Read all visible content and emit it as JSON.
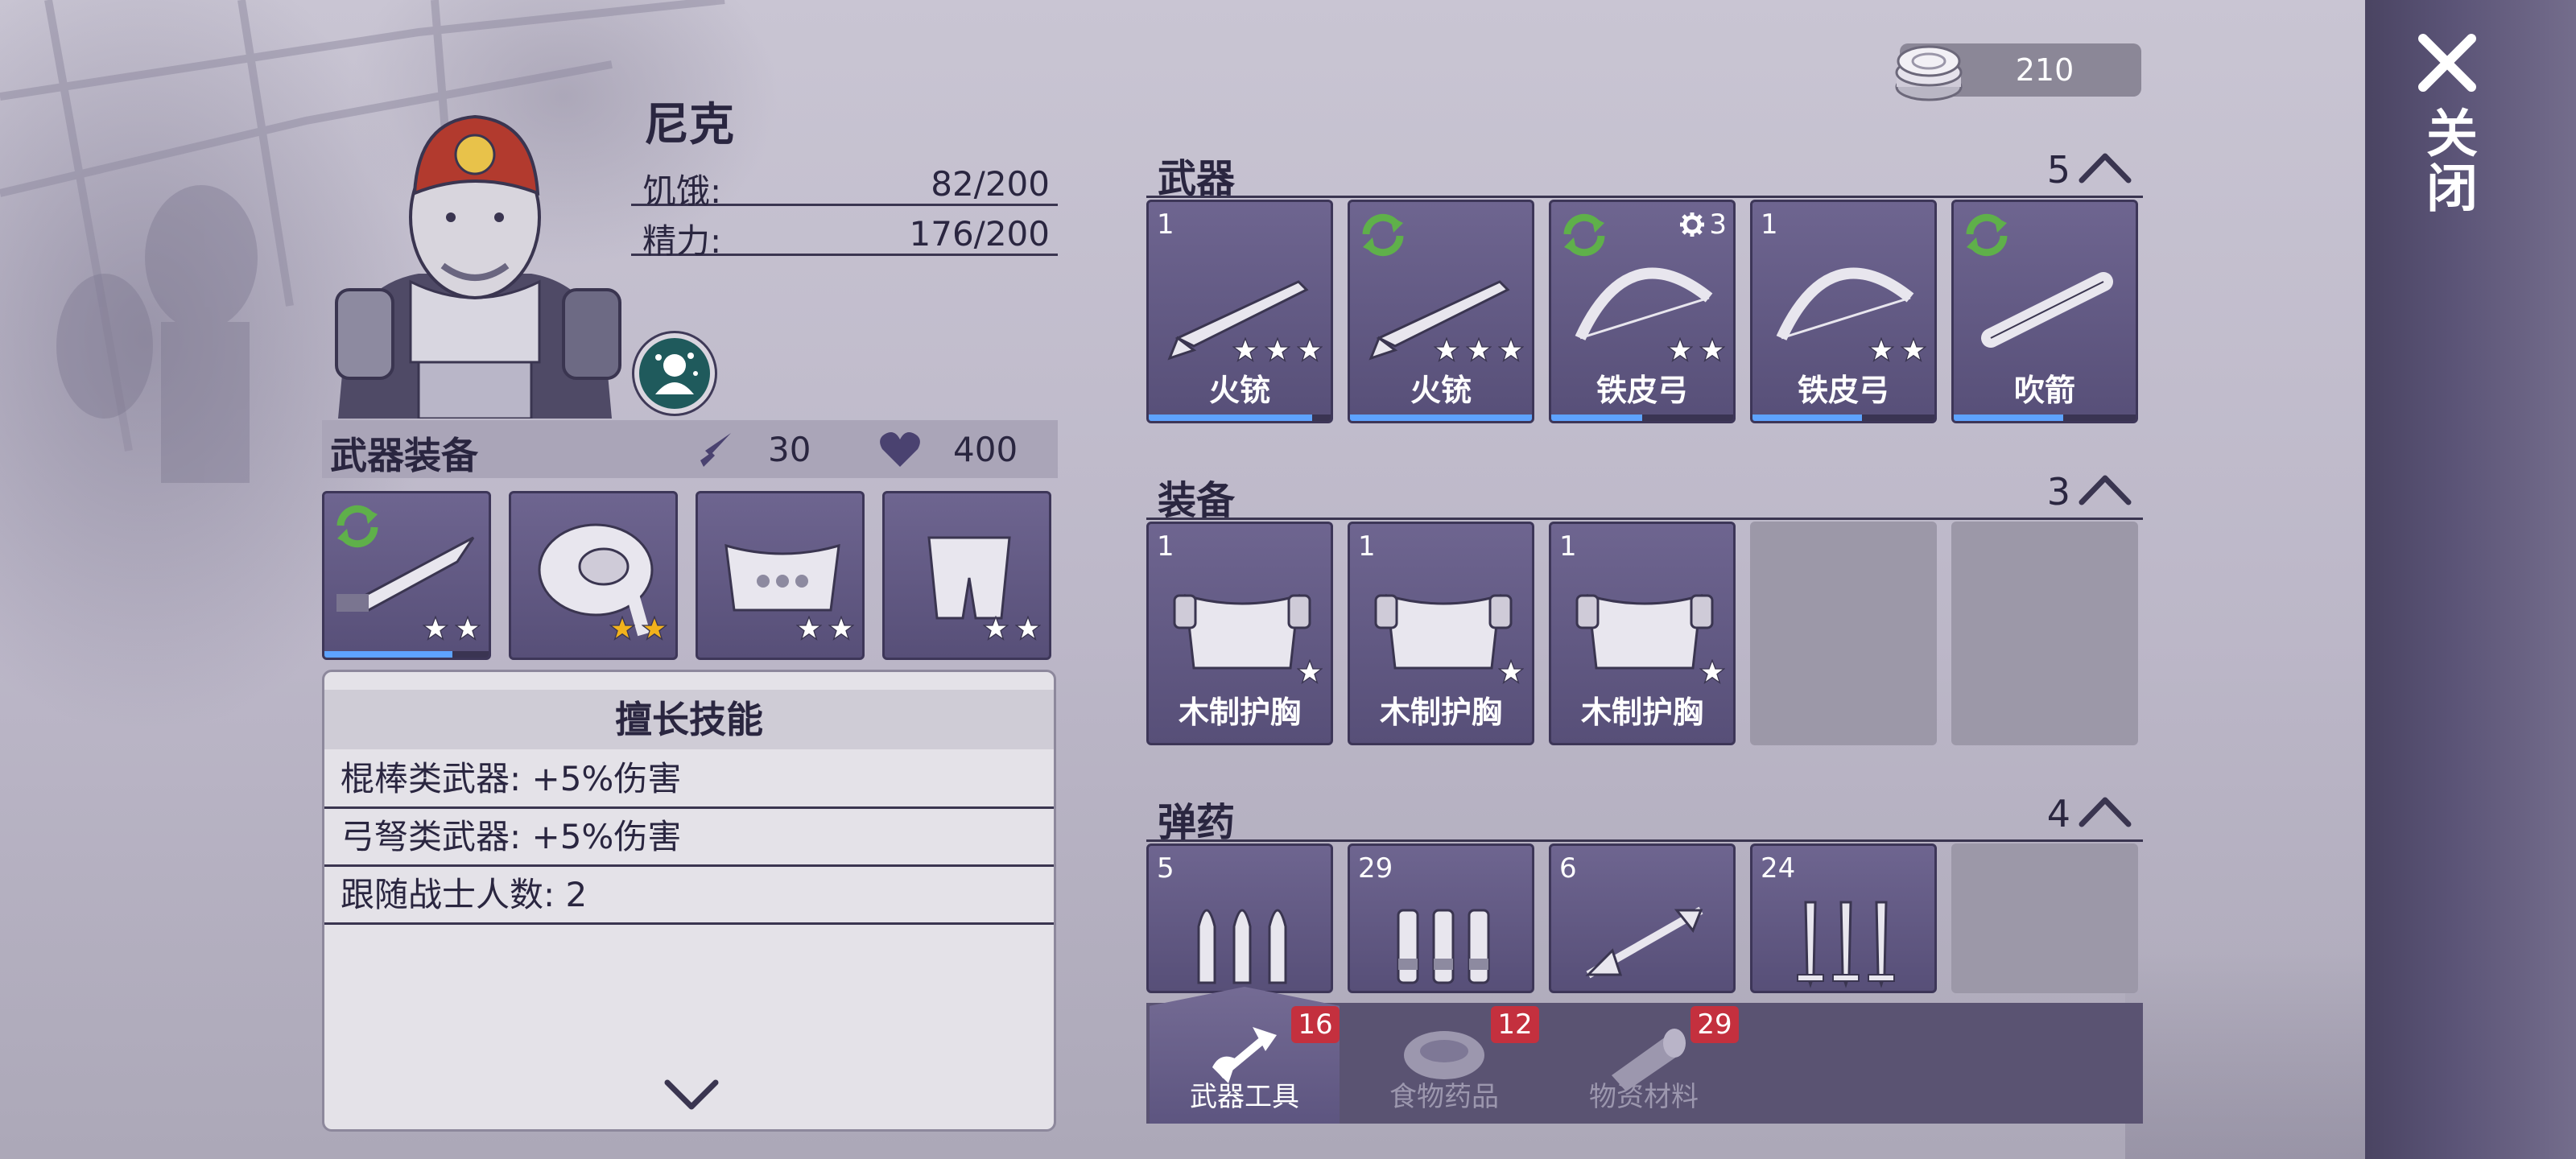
{
  "currency": {
    "value": "210",
    "icon": "coin-stack-icon"
  },
  "close": {
    "label": "关闭"
  },
  "character": {
    "name": "尼克",
    "stats": [
      {
        "label": "饥饿:",
        "value": "82/200"
      },
      {
        "label": "精力:",
        "value": "176/200"
      }
    ]
  },
  "equipment": {
    "title": "武器装备",
    "attack": "30",
    "health": "400",
    "slots": [
      {
        "kind": "knife",
        "stars": 2,
        "star_color": "white",
        "refresh": true,
        "progress": 0.78
      },
      {
        "kind": "bandana",
        "stars": 2,
        "star_color": "gold"
      },
      {
        "kind": "armor",
        "stars": 2,
        "star_color": "white"
      },
      {
        "kind": "pants",
        "stars": 2,
        "star_color": "white"
      }
    ]
  },
  "skills": {
    "title": "擅长技能",
    "rows": [
      "棍棒类武器: +5%伤害",
      "弓弩类武器: +5%伤害",
      "跟随战士人数: 2"
    ]
  },
  "sections": [
    {
      "title": "武器",
      "count": "5",
      "items": [
        {
          "count": "1",
          "name": "火铳",
          "stars": 3,
          "progress": 0.9,
          "art": "musket"
        },
        {
          "count": "",
          "name": "火铳",
          "stars": 3,
          "progress": 1.0,
          "refresh": true,
          "art": "musket"
        },
        {
          "count": "",
          "name": "铁皮弓",
          "stars": 2,
          "progress": 0.5,
          "refresh": true,
          "gear": "3",
          "art": "bow"
        },
        {
          "count": "1",
          "name": "铁皮弓",
          "stars": 2,
          "progress": 0.6,
          "art": "bow"
        },
        {
          "count": "",
          "name": "吹箭",
          "stars": 0,
          "progress": 0.6,
          "refresh": true,
          "art": "blowgun"
        }
      ]
    },
    {
      "title": "装备",
      "count": "3",
      "items": [
        {
          "count": "1",
          "name": "木制护胸",
          "stars": 1,
          "art": "chestplate"
        },
        {
          "count": "1",
          "name": "木制护胸",
          "stars": 1,
          "art": "chestplate"
        },
        {
          "count": "1",
          "name": "木制护胸",
          "stars": 1,
          "art": "chestplate"
        }
      ]
    },
    {
      "title": "弹药",
      "count": "4",
      "items": [
        {
          "count": "5",
          "art": "bullets"
        },
        {
          "count": "29",
          "art": "shells"
        },
        {
          "count": "6",
          "art": "arrow"
        },
        {
          "count": "24",
          "art": "nails"
        }
      ]
    }
  ],
  "tabs": [
    {
      "label": "武器工具",
      "badge": "16",
      "icon": "axe-wrench-icon",
      "active": true
    },
    {
      "label": "食物药品",
      "badge": "12",
      "icon": "meat-icon",
      "active": false
    },
    {
      "label": "物资材料",
      "badge": "29",
      "icon": "log-icon",
      "active": false
    }
  ],
  "colors": {
    "slot_purple": "#6e6590",
    "progress_blue": "#5ea3ff",
    "badge_red": "#c4303e",
    "refresh_green": "#5fb04a",
    "star_gold": "#f2b21c"
  }
}
